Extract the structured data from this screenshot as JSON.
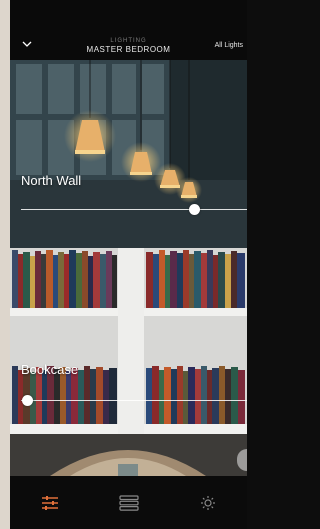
{
  "header": {
    "subtitle": "LIGHTING",
    "title": "MASTER BEDROOM",
    "all_lights_label": "All Lights",
    "back_icon": "chevron-down-icon"
  },
  "cards": [
    {
      "label": "North Wall",
      "level": 0.8
    },
    {
      "label": "Bookcase",
      "level": 0.0
    }
  ],
  "tabbar": {
    "tabs": [
      {
        "icon": "sliders-icon",
        "active": true
      },
      {
        "icon": "list-icon",
        "active": false
      },
      {
        "icon": "sun-icon",
        "active": false
      }
    ]
  },
  "colors": {
    "accent": "#e0703a",
    "inactive_icon": "#8a8a8a",
    "background": "#0d0d0d"
  }
}
